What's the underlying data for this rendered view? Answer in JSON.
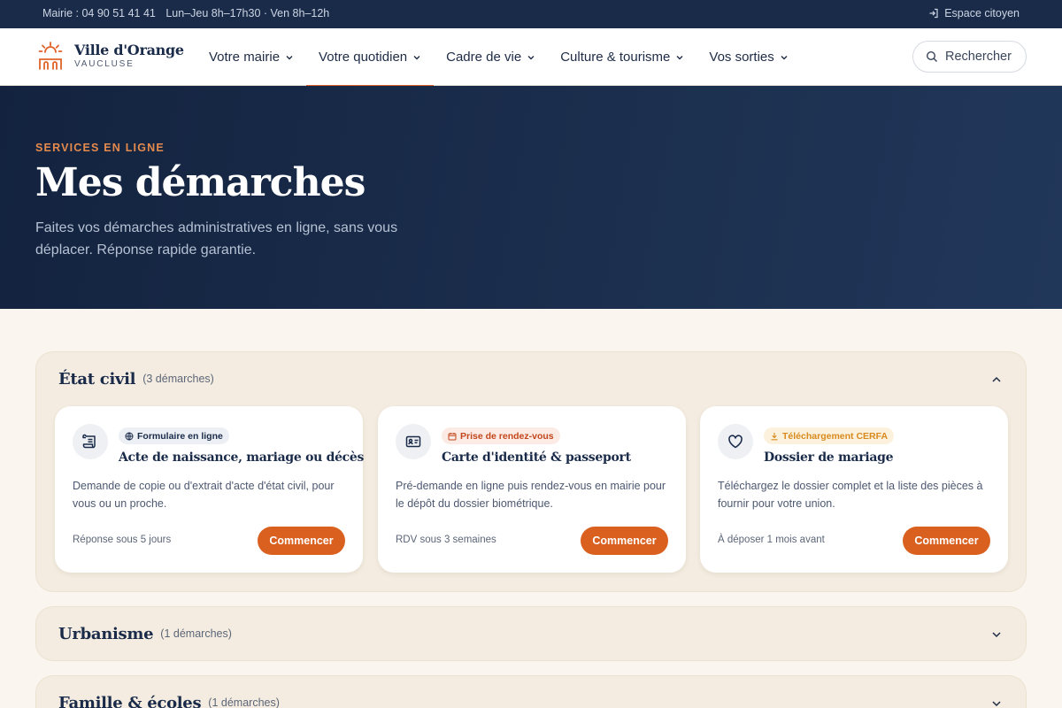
{
  "topbar": {
    "phone": "Mairie : 04 90 51 41 41",
    "hours": "Lun–Jeu 8h–17h30 · Ven 8h–12h",
    "citizen_label": "Espace citoyen"
  },
  "header": {
    "logo_name": "Ville d'Orange",
    "logo_sub": "VAUCLUSE",
    "nav": [
      {
        "label": "Votre mairie"
      },
      {
        "label": "Votre quotidien",
        "active": true
      },
      {
        "label": "Cadre de vie"
      },
      {
        "label": "Culture & tourisme"
      },
      {
        "label": "Vos sorties"
      }
    ],
    "search_label": "Rechercher"
  },
  "hero": {
    "eyebrow": "SERVICES EN LIGNE",
    "title": "Mes démarches",
    "description": "Faites vos démarches administratives en ligne, sans vous déplacer. Réponse rapide garantie."
  },
  "sections": [
    {
      "title": "État civil",
      "count": "(3 démarches)",
      "expanded": true,
      "cards": [
        {
          "icon": "scroll-icon",
          "badge": "Formulaire en ligne",
          "badge_icon": "globe-icon",
          "title": "Acte de naissance, mariage ou décès",
          "description": "Demande de copie ou d'extrait d'acte d'état civil, pour vous ou un proche.",
          "meta": "Réponse sous 5 jours",
          "button": "Commencer"
        },
        {
          "icon": "id-card-icon",
          "badge": "Prise de rendez-vous",
          "badge_icon": "calendar-icon",
          "title": "Carte d'identité & passeport",
          "description": "Pré-demande en ligne puis rendez-vous en mairie pour le dépôt du dossier biométrique.",
          "meta": "RDV sous 3 semaines",
          "button": "Commencer"
        },
        {
          "icon": "heart-icon",
          "badge": "Téléchargement CERFA",
          "badge_icon": "download-icon",
          "title": "Dossier de mariage",
          "description": "Téléchargez le dossier complet et la liste des pièces à fournir pour votre union.",
          "meta": "À déposer 1 mois avant",
          "button": "Commencer"
        }
      ]
    },
    {
      "title": "Urbanisme",
      "count": "(1 démarches)",
      "expanded": false
    },
    {
      "title": "Famille & écoles",
      "count": "(1 démarches)",
      "expanded": false
    }
  ],
  "colors": {
    "navy": "#1a2b4a",
    "accent": "#d9601f",
    "section_bg": "#f4ece0",
    "page_bg": "#faf6ef",
    "badge_blue_bg": "#eceff4",
    "badge_red_bg": "#fcebe4",
    "badge_amber_bg": "#fcf1dc"
  }
}
